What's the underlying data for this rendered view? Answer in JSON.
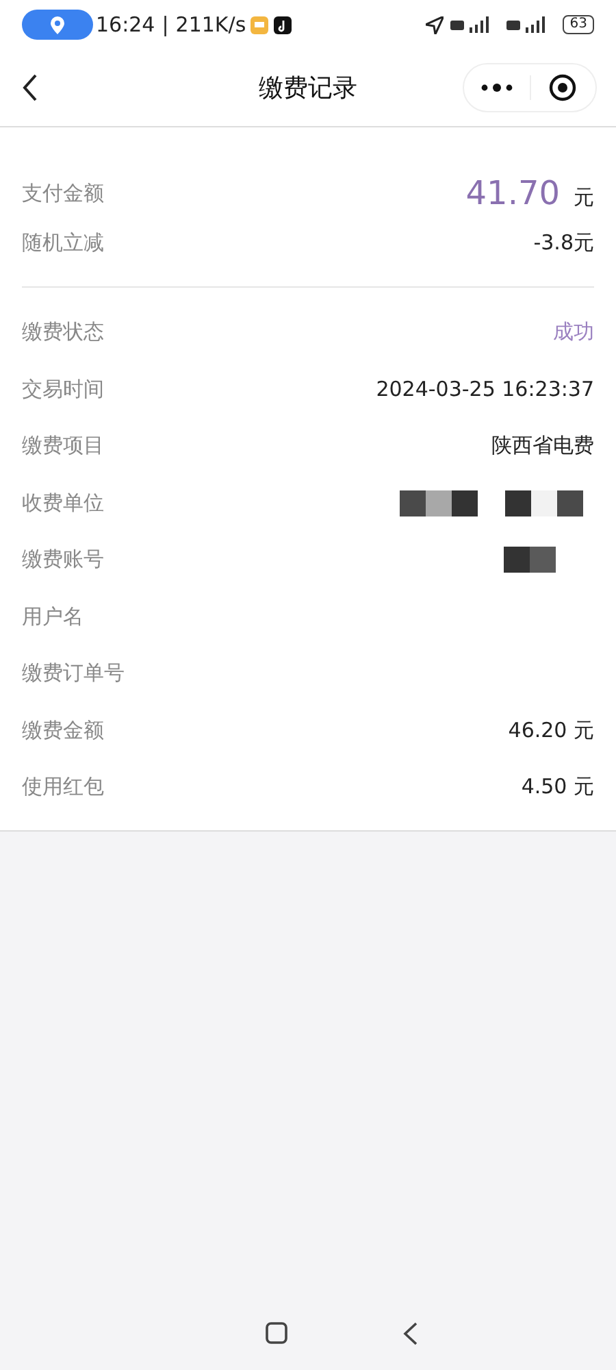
{
  "status_bar": {
    "time": "16:24",
    "separator": "|",
    "speed": "211K/s",
    "battery": "63"
  },
  "header": {
    "title": "缴费记录"
  },
  "summary": [
    {
      "label": "支付金额",
      "kind": "amount",
      "value": "41.70",
      "unit": "元"
    },
    {
      "label": "随机立减",
      "kind": "text",
      "value": "-3.8元"
    }
  ],
  "details": [
    {
      "label": "缴费状态",
      "kind": "status",
      "value": "成功"
    },
    {
      "label": "交易时间",
      "kind": "text",
      "value": "2024-03-25 16:23:37"
    },
    {
      "label": "缴费项目",
      "kind": "text",
      "value": "陕西省电费"
    },
    {
      "label": "收费单位",
      "kind": "redacted"
    },
    {
      "label": "缴费账号",
      "kind": "redacted"
    },
    {
      "label": "用户名",
      "kind": "empty"
    },
    {
      "label": "缴费订单号",
      "kind": "empty"
    },
    {
      "label": "缴费金额",
      "kind": "text",
      "value": "46.20 元"
    },
    {
      "label": "使用红包",
      "kind": "text",
      "value": "4.50 元"
    }
  ]
}
